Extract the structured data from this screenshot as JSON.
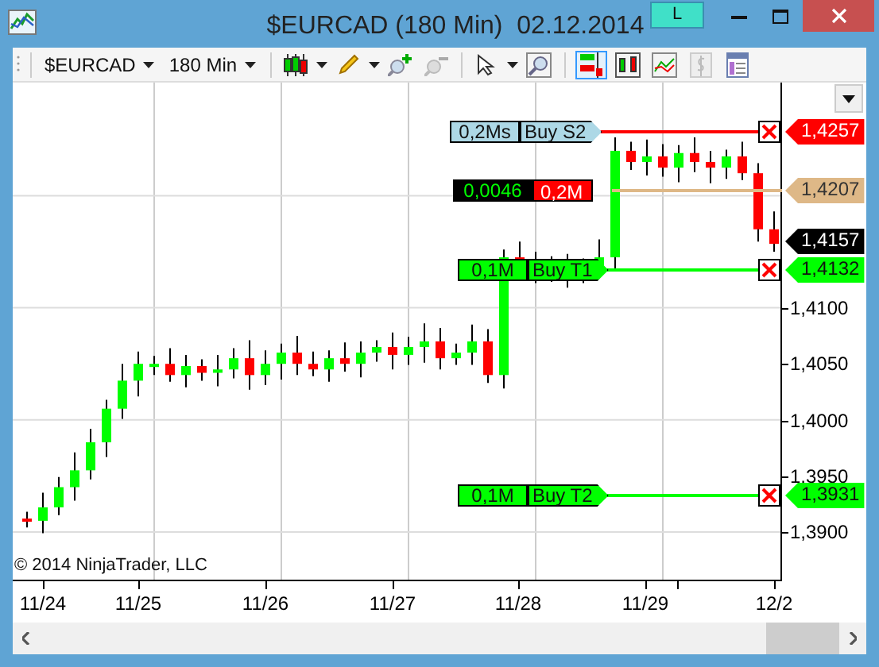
{
  "window": {
    "title": "$EURCAD (180 Min)  02.12.2014",
    "badge": "L"
  },
  "toolbar": {
    "instrument": "$EURCAD",
    "interval": "180 Min"
  },
  "chart": {
    "price_labels": [
      "1,4100",
      "1,4050",
      "1,4000",
      "1,3950",
      "1,3900"
    ],
    "time_labels": [
      "11/24",
      "11/25",
      "11/26",
      "11/27",
      "11/28",
      "11/29",
      "12/2"
    ],
    "copyright": "© 2014 NinjaTrader, LLC",
    "orders": [
      {
        "kind": "stop_order",
        "quantity": "0,2Ms",
        "label": "Buy S2",
        "color": "#ff0000",
        "price": "1,4257"
      },
      {
        "kind": "position",
        "pnl": "0,0046",
        "quantity": "0,2M",
        "color": "#deb887",
        "price": "1,4207"
      },
      {
        "kind": "last",
        "price": "1,4157"
      },
      {
        "kind": "limit_order",
        "quantity": "0,1M",
        "label": "Buy T1",
        "color": "#00ff00",
        "price": "1,4132"
      },
      {
        "kind": "limit_order",
        "quantity": "0,1M",
        "label": "Buy T2",
        "color": "#00ff00",
        "price": "1,3931"
      }
    ]
  }
}
